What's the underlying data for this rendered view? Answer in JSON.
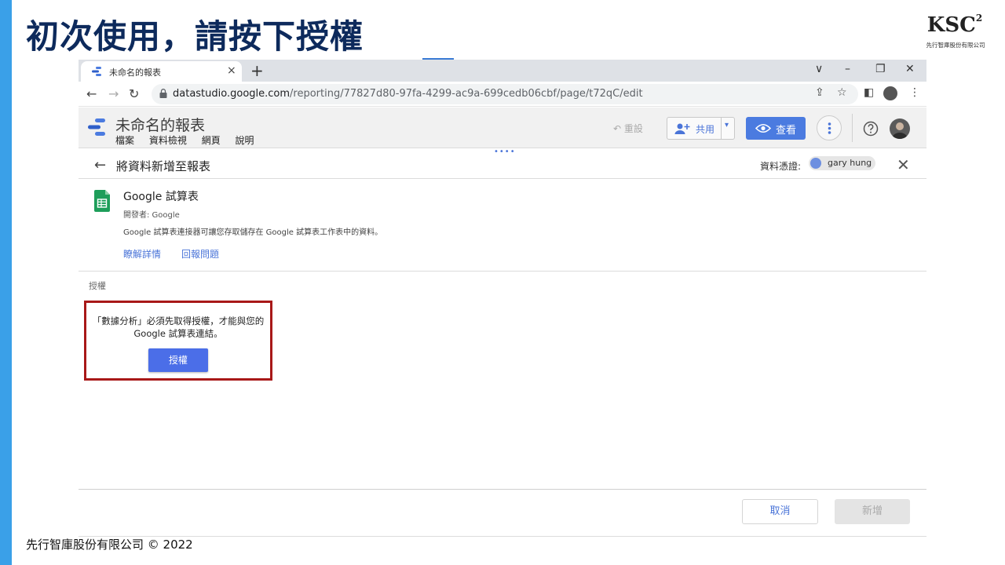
{
  "slide": {
    "title": "初次使用，請按下授權",
    "footer": "先行智庫股份有限公司 © 2022",
    "logo_text": "KSC",
    "logo_sup": "2",
    "logo_caption": "先行智庫股份有限公司"
  },
  "browser": {
    "tab_title": "未命名的報表",
    "tab_close": "×",
    "new_tab": "+",
    "window_controls": [
      "∨",
      "–",
      "❐",
      "✕"
    ],
    "url_host": "datastudio.google.com",
    "url_path": "/reporting/77827d80-97fa-4299-ac9a-699cedb06cbf/page/t72qC/edit"
  },
  "app": {
    "report_title": "未命名的報表",
    "menu": [
      "檔案",
      "資料檢視",
      "網頁",
      "說明"
    ],
    "reset_label": "重設",
    "share_label": "共用",
    "view_label": "查看"
  },
  "panel": {
    "title": "將資料新增至報表",
    "credentials_label": "資料憑證:",
    "credentials_user": "gary hung",
    "connector": {
      "name": "Google 試算表",
      "developer": "開發者: Google",
      "description": "Google 試算表連接器可讓您存取儲存在 Google 試算表工作表中的資料。",
      "learn_more": "瞭解詳情",
      "report_issue": "回報問題"
    },
    "auth": {
      "section_label": "授權",
      "message_line1": "「數據分析」必須先取得授權，才能與您的",
      "message_line2": "Google 試算表連結。",
      "button": "授權"
    },
    "cancel": "取消",
    "add": "新增"
  },
  "colors": {
    "accent_blue": "#4b7be0",
    "title_navy": "#0d2a5c",
    "highlight_red": "#a81818",
    "left_bar": "#3aa0e8"
  }
}
